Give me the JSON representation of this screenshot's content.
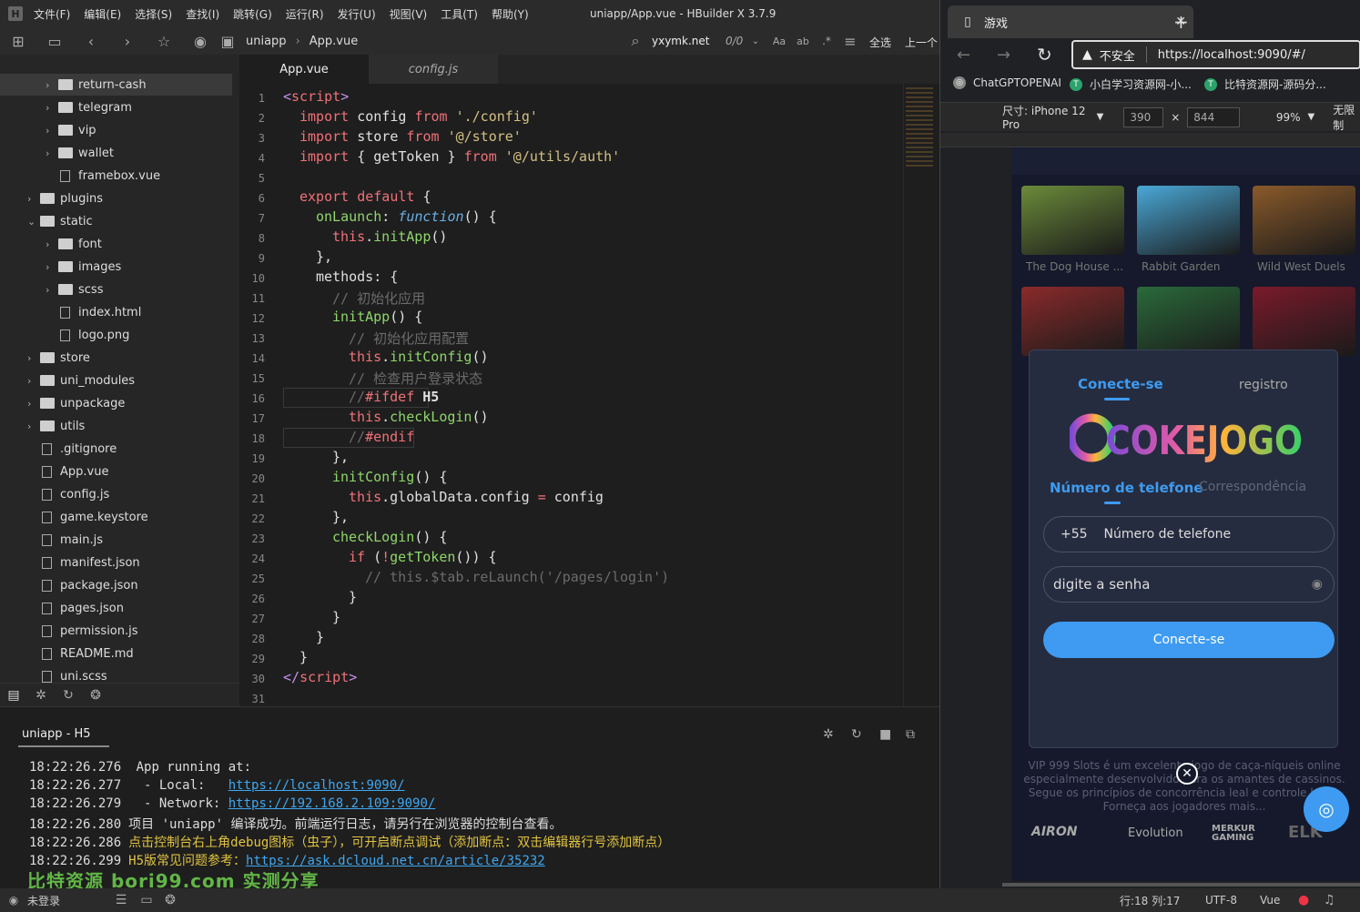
{
  "window": {
    "title": "uniapp/App.vue - HBuilder X 3.7.9",
    "menus": [
      "文件(F)",
      "编辑(E)",
      "选择(S)",
      "查找(I)",
      "跳转(G)",
      "运行(R)",
      "发行(U)",
      "视图(V)",
      "工具(T)",
      "帮助(Y)"
    ]
  },
  "toolbar": {
    "breadcrumb": [
      "uniapp",
      "App.vue"
    ],
    "search_value": "yxymk.net",
    "match_count": "0/0",
    "select_all": "全选",
    "prev": "上一个"
  },
  "explorer": {
    "items": [
      {
        "label": "return-cash",
        "type": "folder",
        "level": 2,
        "expanded": false
      },
      {
        "label": "telegram",
        "type": "folder",
        "level": 2,
        "expanded": false
      },
      {
        "label": "vip",
        "type": "folder",
        "level": 2,
        "expanded": false
      },
      {
        "label": "wallet",
        "type": "folder",
        "level": 2,
        "expanded": false
      },
      {
        "label": "framebox.vue",
        "type": "file",
        "level": 2
      },
      {
        "label": "plugins",
        "type": "folder",
        "level": 1,
        "expanded": false
      },
      {
        "label": "static",
        "type": "folder",
        "level": 1,
        "expanded": true
      },
      {
        "label": "font",
        "type": "folder",
        "level": 2,
        "expanded": false
      },
      {
        "label": "images",
        "type": "folder",
        "level": 2,
        "expanded": false
      },
      {
        "label": "scss",
        "type": "folder",
        "level": 2,
        "expanded": false
      },
      {
        "label": "index.html",
        "type": "file",
        "level": 2
      },
      {
        "label": "logo.png",
        "type": "file",
        "level": 2
      },
      {
        "label": "store",
        "type": "folder",
        "level": 1,
        "expanded": false
      },
      {
        "label": "uni_modules",
        "type": "folder",
        "level": 1,
        "expanded": false
      },
      {
        "label": "unpackage",
        "type": "folder",
        "level": 1,
        "expanded": false
      },
      {
        "label": "utils",
        "type": "folder",
        "level": 1,
        "expanded": false
      },
      {
        "label": ".gitignore",
        "type": "file",
        "level": 1
      },
      {
        "label": "App.vue",
        "type": "file",
        "level": 1
      },
      {
        "label": "config.js",
        "type": "file",
        "level": 1
      },
      {
        "label": "game.keystore",
        "type": "file",
        "level": 1
      },
      {
        "label": "main.js",
        "type": "file",
        "level": 1
      },
      {
        "label": "manifest.json",
        "type": "file",
        "level": 1
      },
      {
        "label": "package.json",
        "type": "file",
        "level": 1
      },
      {
        "label": "pages.json",
        "type": "file",
        "level": 1
      },
      {
        "label": "permission.js",
        "type": "file",
        "level": 1
      },
      {
        "label": "README.md",
        "type": "file",
        "level": 1
      },
      {
        "label": "uni.scss",
        "type": "file",
        "level": 1
      }
    ]
  },
  "editor": {
    "tabs": [
      {
        "label": "App.vue",
        "active": true
      },
      {
        "label": "config.js",
        "active": false
      }
    ]
  },
  "console": {
    "title": "uniapp - H5",
    "lines": [
      {
        "time": "18:22:26.276",
        "text": " App running at:",
        "color": "default"
      },
      {
        "time": "18:22:26.277",
        "text": "  - Local:   ",
        "link": "https://localhost:9090/",
        "color": "default"
      },
      {
        "time": "18:22:26.279",
        "text": "  - Network: ",
        "link": "https://192.168.2.109:9090/",
        "color": "default"
      },
      {
        "time": "18:22:26.280",
        "text": "项目 'uniapp' 编译成功。前端运行日志，请另行在浏览器的控制台查看。",
        "color": "default"
      },
      {
        "time": "18:22:26.286",
        "text": "点击控制台右上角debug图标（虫子），可开启断点调试（添加断点：双击编辑器行号添加断点）",
        "color": "#e0c341"
      },
      {
        "time": "18:22:26.299",
        "text": "H5版常见问题参考：",
        "link": "https://ask.dcloud.net.cn/article/35232",
        "color": "#e0c341"
      }
    ],
    "watermark": "比特资源 bori99.com 实测分享"
  },
  "statusbar": {
    "login": "未登录",
    "position": "行:18  列:17",
    "encoding": "UTF-8",
    "language": "Vue"
  },
  "browser": {
    "tab_title": "游戏",
    "insecure": "不安全",
    "url": "https://localhost:9090/#/",
    "bookmarks": [
      "ChatGPTOPENAI",
      "小白学习资源网-小...",
      "比特资源网-源码分..."
    ],
    "device": "尺寸: iPhone 12 Pro",
    "width": "390",
    "height": "844",
    "zoom": "99%",
    "throttle": "无限制"
  },
  "app": {
    "games": [
      {
        "name": "The Dog House ...",
        "color": "#6b8b3a"
      },
      {
        "name": "Rabbit Garden",
        "color": "#4aa8d6"
      },
      {
        "name": "Wild West Duels",
        "color": "#8a5a2a"
      },
      {
        "name": "",
        "color": "#8a2a2a"
      },
      {
        "name": "",
        "color": "#2a6a3a"
      },
      {
        "name": "",
        "color": "#7a1a2a"
      }
    ],
    "login_tab": "Conecte-se",
    "register_tab": "registro",
    "brand": "COKEJOGO",
    "phone_tab": "Número de telefone",
    "email_tab": "Correspondência",
    "country_code": "+55",
    "phone_placeholder": "Número de telefone",
    "password_placeholder": "digite a senha",
    "submit": "Conecte-se",
    "footer_text": "VIP 999 Slots é um excelente jogo de caça-níqueis online especialmente desenvolvido para os amantes de cassinos. Segue os princípios de concorrência leal e controle legal. Forneça aos jogadores mais...",
    "providers": [
      "AIRON",
      "Evolution",
      "MERKUR GAMING",
      "ELK"
    ],
    "accent": "#3e9bf1"
  }
}
